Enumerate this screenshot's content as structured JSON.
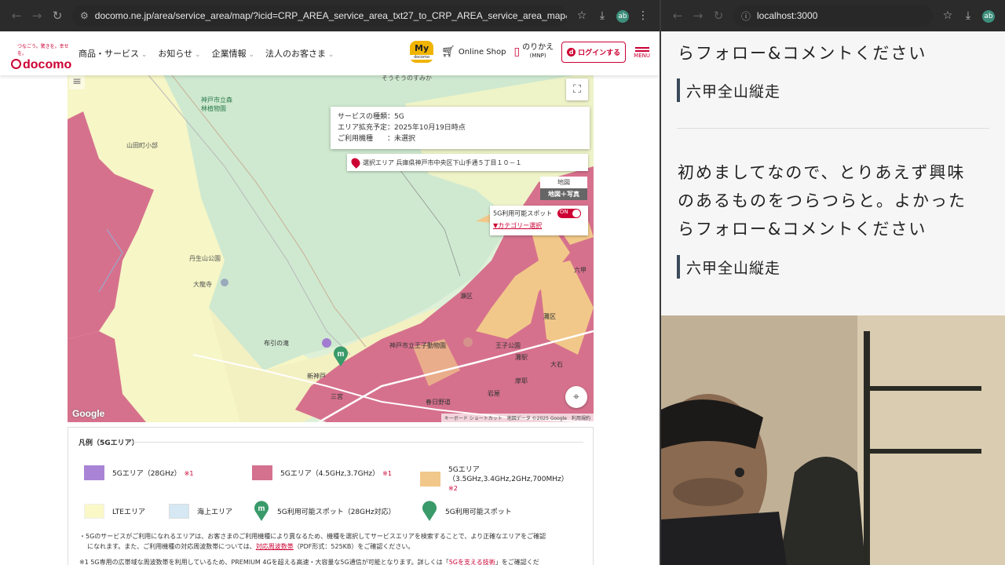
{
  "left_browser": {
    "url": "docomo.ne.jp/area/service_area/map/?icid=CRP_AREA_service_area_txt27_to_CRP_AREA_service_area_map&rgcd=06&cmcd..."
  },
  "docomo_header": {
    "logo_tagline": "つなごう。驚きを。幸せを。",
    "logo_text": "docomo",
    "nav": [
      "商品・サービス",
      "お知らせ",
      "企業情報",
      "法人のお客さま"
    ],
    "my_label": "My",
    "my_sub": "docomo",
    "online_shop": "Online Shop",
    "mnp_label": "のりかえ",
    "mnp_sub": "(MNP)",
    "login": "ログインする",
    "menu": "MENU"
  },
  "map": {
    "info_lines": [
      "サービスの種類：5G",
      "エリア拡充予定：2025年10月19日時点",
      "ご利用機種　　：未選択"
    ],
    "selected_area": "選択エリア 兵庫県神戸市中央区下山手通５丁目１０－１",
    "map_type": [
      "地図",
      "地図＋写真"
    ],
    "spot_label": "5G利用可能スポット",
    "toggle": "ON",
    "category": "▼カテゴリー選択",
    "place_labels": [
      "山田町小部",
      "神戸市立森林植物園",
      "そうそうのすみか",
      "丹生山公園",
      "大龍寺",
      "布引の滝",
      "神戸市立王子動物園",
      "王子公園",
      "灘区",
      "六甲",
      "大石",
      "岩屋",
      "新神戸",
      "春日野道",
      "三宮",
      "瀬区",
      "灘駅",
      "摩耶"
    ],
    "google": "Google",
    "attribution": "キーボード ショートカット　地図データ ©2025 Google　利用規約"
  },
  "legend": {
    "title": "凡例（5Gエリア）",
    "items": [
      {
        "label": "5Gエリア（28GHz）",
        "note": "※1",
        "color": "#a984d6"
      },
      {
        "label": "5Gエリア（4.5GHz,3.7GHz）",
        "note": "※1",
        "color": "#d4718e"
      },
      {
        "label": "5Gエリア",
        "label2": "（3.5GHz,3.4GHz,2GHz,700MHz）",
        "note": "※2",
        "color": "#f1c88a"
      },
      {
        "label": "LTEエリア",
        "color": "#fbf8c8"
      },
      {
        "label": "海上エリア",
        "color": "#d5e8f4"
      },
      {
        "label": "5G利用可能スポット（28GHz対応）",
        "color": "#3a9a6a"
      },
      {
        "label": "5G利用可能スポット",
        "color": "#3a9a6a"
      }
    ],
    "footnote1_a": "・5Gのサービスがご利用になれるエリアは、お客さまのご利用機種により異なるため、機種を選択してサービスエリアを検索することで、より正確なエリアをご確認",
    "footnote1_b": "になれます。また、ご利用機種の対応周波数帯については、",
    "footnote1_link": "対応周波数帯",
    "footnote1_c": "（PDF形式：525KB）をご確認ください。",
    "footnote2_a": "※1 5G専用の広帯域な周波数帯を利用しているため、PREMIUM 4Gを超える高速・大容量な5G通信が可能となります。詳しくは「",
    "footnote2_link": "5Gを支える技術",
    "footnote2_b": "」をご確認くだ"
  },
  "right_browser": {
    "url": "localhost:3000",
    "line_top": "らフォロー&コメントください",
    "heading1": "六甲全山縦走",
    "para": [
      "初めましてなので、とりあえず興味",
      "のあるものをつらつらと。よかった",
      "らフォロー&コメントください"
    ],
    "heading2": "六甲全山縦走"
  }
}
